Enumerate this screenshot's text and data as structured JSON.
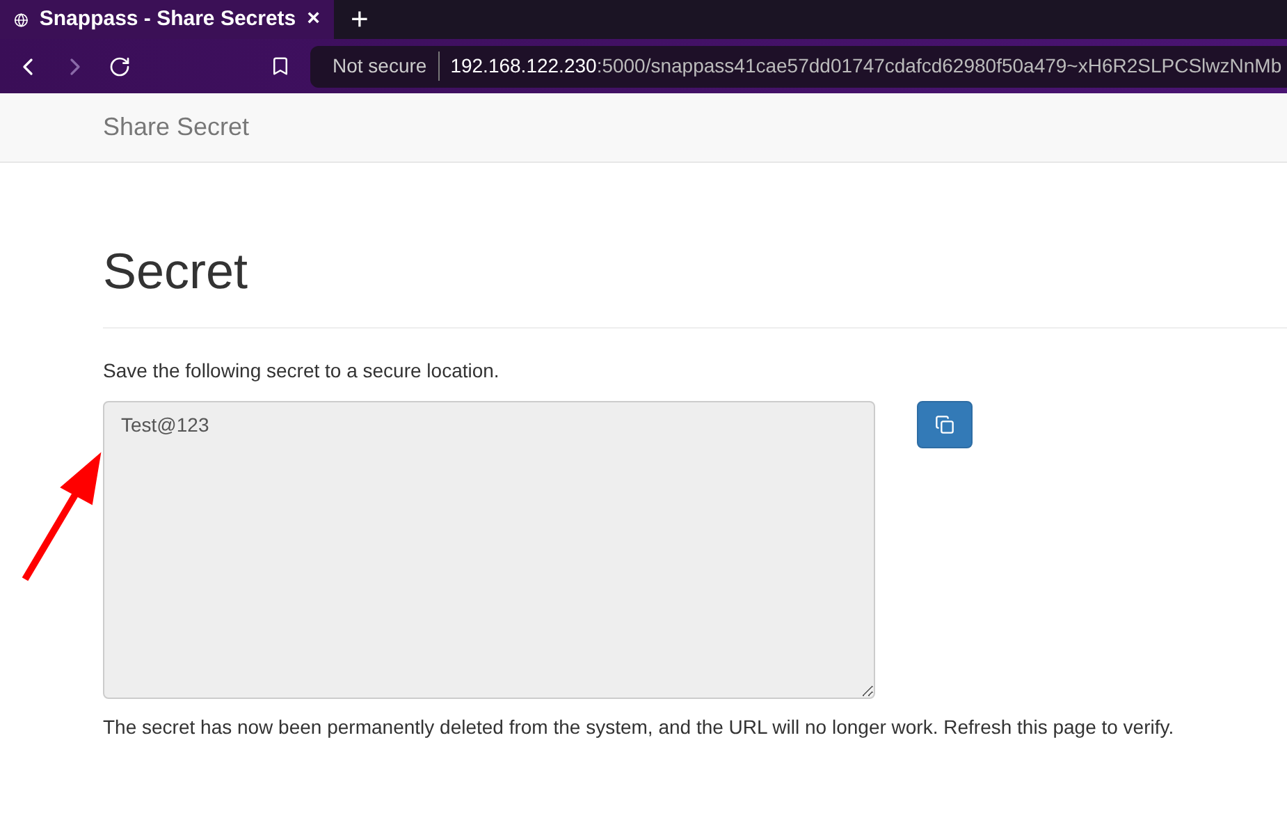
{
  "browser": {
    "tab_title": "Snappass - Share Secrets",
    "close_glyph": "×",
    "new_tab_glyph": "+",
    "security_label": "Not secure",
    "url_host": "192.168.122.230",
    "url_rest": ":5000/snappass41cae57dd01747cdafcd62980f50a479~xH6R2SLPCSlwzNnMb"
  },
  "navbar": {
    "brand": "Share Secret"
  },
  "page": {
    "heading": "Secret",
    "instruction": "Save the following secret to a secure location.",
    "secret_value": "Test@123",
    "notice": "The secret has now been permanently deleted from the system, and the URL will no longer work. Refresh this page to verify."
  }
}
